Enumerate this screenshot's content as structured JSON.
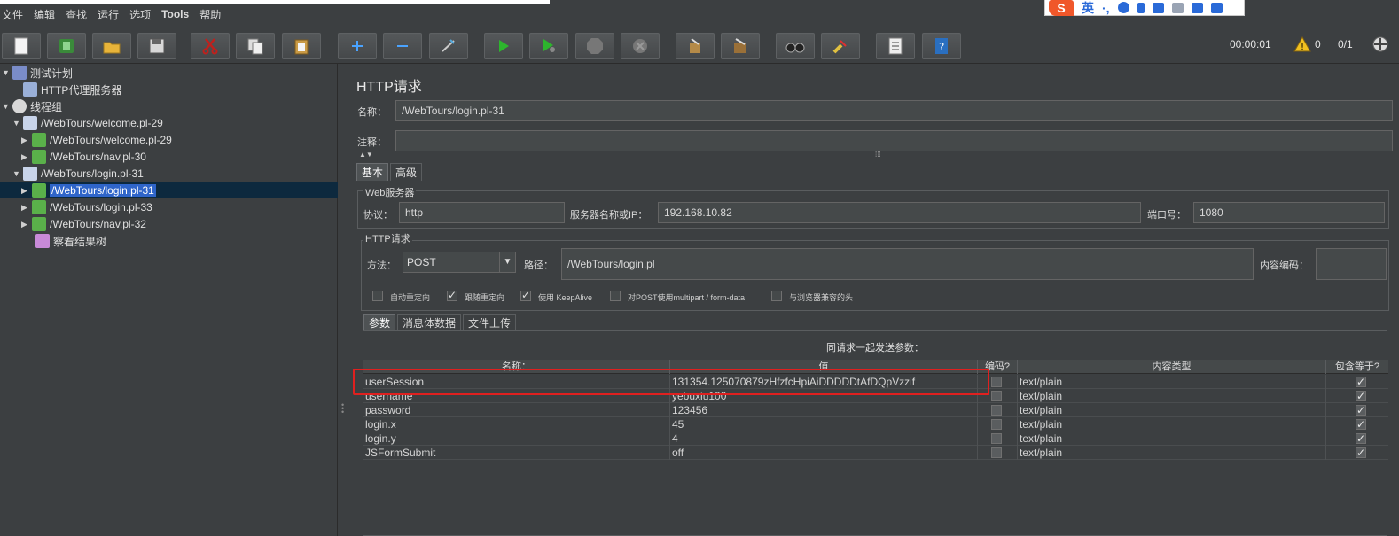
{
  "menu": [
    "文件",
    "编辑",
    "查找",
    "运行",
    "选项",
    "Tools",
    "帮助"
  ],
  "toolbar": {
    "timer": "00:00:01",
    "warnings": "0",
    "threads": "0/1"
  },
  "ime": {
    "lang": "英",
    "punct": "·,"
  },
  "tree": [
    {
      "label": "测试计划",
      "icon": "test-plan-icon",
      "level": 0,
      "expanded": true
    },
    {
      "label": "HTTP代理服务器",
      "icon": "proxy-server-icon",
      "level": 1
    },
    {
      "label": "线程组",
      "icon": "thread-group-icon",
      "level": 0,
      "expanded": true
    },
    {
      "label": "/WebTours/welcome.pl-29",
      "icon": "transaction-controller-icon",
      "level": 1,
      "expanded": true
    },
    {
      "label": "/WebTours/welcome.pl-29",
      "icon": "http-sampler-icon",
      "level": 2
    },
    {
      "label": "/WebTours/nav.pl-30",
      "icon": "http-sampler-icon",
      "level": 2
    },
    {
      "label": "/WebTours/login.pl-31",
      "icon": "transaction-controller-icon",
      "level": 1,
      "expanded": true
    },
    {
      "label": "/WebTours/login.pl-31",
      "icon": "http-sampler-icon",
      "level": 2,
      "selected": true
    },
    {
      "label": "/WebTours/login.pl-33",
      "icon": "http-sampler-icon",
      "level": 2
    },
    {
      "label": "/WebTours/nav.pl-32",
      "icon": "http-sampler-icon",
      "level": 2
    },
    {
      "label": "察看结果树",
      "icon": "results-tree-icon",
      "level": 1
    }
  ],
  "panel": {
    "title": "HTTP请求",
    "name_label": "名称：",
    "name_value": "/WebTours/login.pl-31",
    "comment_label": "注释：",
    "comment_value": "",
    "tabs": [
      "基本",
      "高级"
    ],
    "web_server": {
      "title": "Web服务器",
      "protocol_label": "协议：",
      "protocol_value": "http",
      "server_label": "服务器名称或IP：",
      "server_value": "192.168.10.82",
      "port_label": "端口号：",
      "port_value": "1080"
    },
    "http_request": {
      "title": "HTTP请求",
      "method_label": "方法：",
      "method_value": "POST",
      "path_label": "路径：",
      "path_value": "/WebTours/login.pl",
      "encoding_label": "内容编码：",
      "encoding_value": ""
    },
    "options": [
      {
        "label": "自动重定向",
        "checked": false
      },
      {
        "label": "跟随重定向",
        "checked": true
      },
      {
        "label": "使用 KeepAlive",
        "checked": true
      },
      {
        "label": "对POST使用multipart / form-data",
        "checked": false
      },
      {
        "label": "与浏览器兼容的头",
        "checked": false
      }
    ],
    "param_tabs": [
      "参数",
      "消息体数据",
      "文件上传"
    ],
    "params_caption": "同请求一起发送参数：",
    "columns": [
      "名称：",
      "值",
      "编码?",
      "内容类型",
      "包含等于?"
    ],
    "params": [
      {
        "name": "userSession",
        "value": "131354.125070879zHfzfcHpiAiDDDDDtAfDQpVzzif",
        "encode": false,
        "content_type": "text/plain",
        "include_equals": true
      },
      {
        "name": "username",
        "value": "yebuxiu100",
        "encode": false,
        "content_type": "text/plain",
        "include_equals": true
      },
      {
        "name": "password",
        "value": "123456",
        "encode": false,
        "content_type": "text/plain",
        "include_equals": true
      },
      {
        "name": "login.x",
        "value": "45",
        "encode": false,
        "content_type": "text/plain",
        "include_equals": true
      },
      {
        "name": "login.y",
        "value": "4",
        "encode": false,
        "content_type": "text/plain",
        "include_equals": true
      },
      {
        "name": "JSFormSubmit",
        "value": "off",
        "encode": false,
        "content_type": "text/plain",
        "include_equals": true
      }
    ]
  },
  "colors": {
    "background": "#3c3f41",
    "selection": "#2f65ca",
    "highlight_box": "#e0201f"
  }
}
